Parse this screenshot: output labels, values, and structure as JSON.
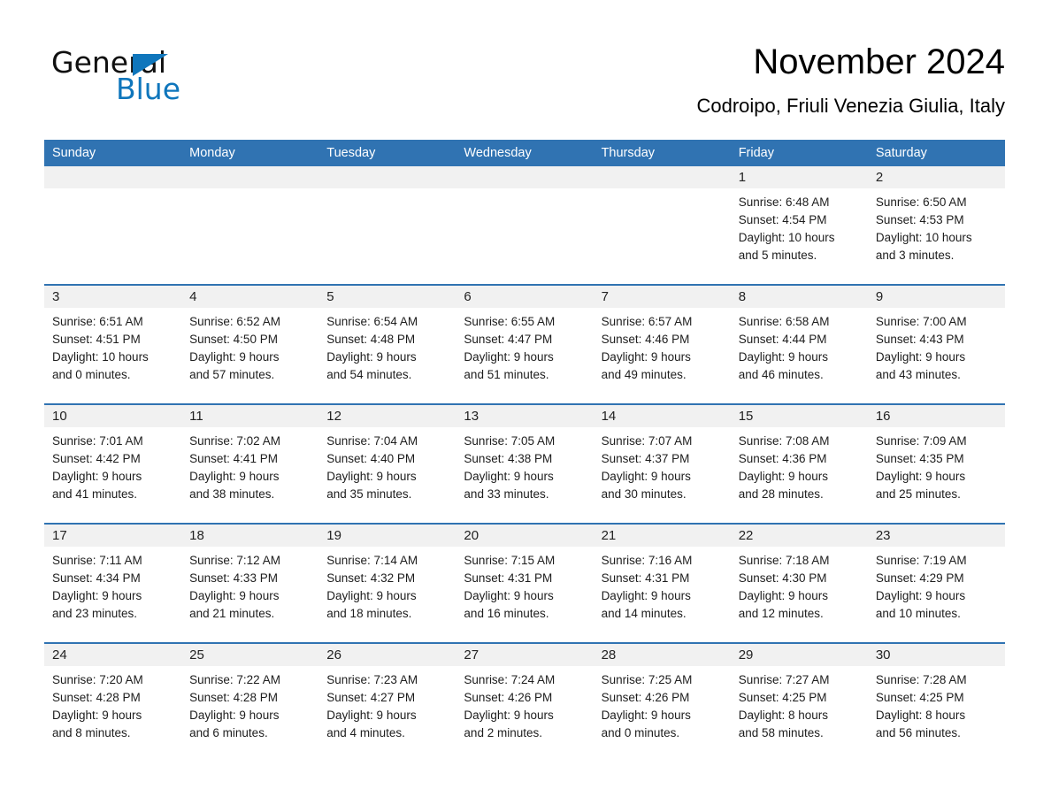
{
  "brand": {
    "name_part1": "General",
    "name_part2": "Blue",
    "accent_color": "#0f76bc",
    "triangle_icon": "triangle-logo-icon"
  },
  "header": {
    "title": "November 2024",
    "location": "Codroipo, Friuli Venezia Giulia, Italy"
  },
  "calendar": {
    "header_color": "#3073b2",
    "daynum_band_color": "#f1f1f1",
    "weekdays": [
      "Sunday",
      "Monday",
      "Tuesday",
      "Wednesday",
      "Thursday",
      "Friday",
      "Saturday"
    ],
    "labels": {
      "sunrise": "Sunrise:",
      "sunset": "Sunset:",
      "daylight": "Daylight:"
    },
    "weeks": [
      [
        {
          "day": "",
          "sunrise": "",
          "sunset": "",
          "daylight_line1": "",
          "daylight_line2": ""
        },
        {
          "day": "",
          "sunrise": "",
          "sunset": "",
          "daylight_line1": "",
          "daylight_line2": ""
        },
        {
          "day": "",
          "sunrise": "",
          "sunset": "",
          "daylight_line1": "",
          "daylight_line2": ""
        },
        {
          "day": "",
          "sunrise": "",
          "sunset": "",
          "daylight_line1": "",
          "daylight_line2": ""
        },
        {
          "day": "",
          "sunrise": "",
          "sunset": "",
          "daylight_line1": "",
          "daylight_line2": ""
        },
        {
          "day": "1",
          "sunrise": "Sunrise: 6:48 AM",
          "sunset": "Sunset: 4:54 PM",
          "daylight_line1": "Daylight: 10 hours",
          "daylight_line2": "and 5 minutes."
        },
        {
          "day": "2",
          "sunrise": "Sunrise: 6:50 AM",
          "sunset": "Sunset: 4:53 PM",
          "daylight_line1": "Daylight: 10 hours",
          "daylight_line2": "and 3 minutes."
        }
      ],
      [
        {
          "day": "3",
          "sunrise": "Sunrise: 6:51 AM",
          "sunset": "Sunset: 4:51 PM",
          "daylight_line1": "Daylight: 10 hours",
          "daylight_line2": "and 0 minutes."
        },
        {
          "day": "4",
          "sunrise": "Sunrise: 6:52 AM",
          "sunset": "Sunset: 4:50 PM",
          "daylight_line1": "Daylight: 9 hours",
          "daylight_line2": "and 57 minutes."
        },
        {
          "day": "5",
          "sunrise": "Sunrise: 6:54 AM",
          "sunset": "Sunset: 4:48 PM",
          "daylight_line1": "Daylight: 9 hours",
          "daylight_line2": "and 54 minutes."
        },
        {
          "day": "6",
          "sunrise": "Sunrise: 6:55 AM",
          "sunset": "Sunset: 4:47 PM",
          "daylight_line1": "Daylight: 9 hours",
          "daylight_line2": "and 51 minutes."
        },
        {
          "day": "7",
          "sunrise": "Sunrise: 6:57 AM",
          "sunset": "Sunset: 4:46 PM",
          "daylight_line1": "Daylight: 9 hours",
          "daylight_line2": "and 49 minutes."
        },
        {
          "day": "8",
          "sunrise": "Sunrise: 6:58 AM",
          "sunset": "Sunset: 4:44 PM",
          "daylight_line1": "Daylight: 9 hours",
          "daylight_line2": "and 46 minutes."
        },
        {
          "day": "9",
          "sunrise": "Sunrise: 7:00 AM",
          "sunset": "Sunset: 4:43 PM",
          "daylight_line1": "Daylight: 9 hours",
          "daylight_line2": "and 43 minutes."
        }
      ],
      [
        {
          "day": "10",
          "sunrise": "Sunrise: 7:01 AM",
          "sunset": "Sunset: 4:42 PM",
          "daylight_line1": "Daylight: 9 hours",
          "daylight_line2": "and 41 minutes."
        },
        {
          "day": "11",
          "sunrise": "Sunrise: 7:02 AM",
          "sunset": "Sunset: 4:41 PM",
          "daylight_line1": "Daylight: 9 hours",
          "daylight_line2": "and 38 minutes."
        },
        {
          "day": "12",
          "sunrise": "Sunrise: 7:04 AM",
          "sunset": "Sunset: 4:40 PM",
          "daylight_line1": "Daylight: 9 hours",
          "daylight_line2": "and 35 minutes."
        },
        {
          "day": "13",
          "sunrise": "Sunrise: 7:05 AM",
          "sunset": "Sunset: 4:38 PM",
          "daylight_line1": "Daylight: 9 hours",
          "daylight_line2": "and 33 minutes."
        },
        {
          "day": "14",
          "sunrise": "Sunrise: 7:07 AM",
          "sunset": "Sunset: 4:37 PM",
          "daylight_line1": "Daylight: 9 hours",
          "daylight_line2": "and 30 minutes."
        },
        {
          "day": "15",
          "sunrise": "Sunrise: 7:08 AM",
          "sunset": "Sunset: 4:36 PM",
          "daylight_line1": "Daylight: 9 hours",
          "daylight_line2": "and 28 minutes."
        },
        {
          "day": "16",
          "sunrise": "Sunrise: 7:09 AM",
          "sunset": "Sunset: 4:35 PM",
          "daylight_line1": "Daylight: 9 hours",
          "daylight_line2": "and 25 minutes."
        }
      ],
      [
        {
          "day": "17",
          "sunrise": "Sunrise: 7:11 AM",
          "sunset": "Sunset: 4:34 PM",
          "daylight_line1": "Daylight: 9 hours",
          "daylight_line2": "and 23 minutes."
        },
        {
          "day": "18",
          "sunrise": "Sunrise: 7:12 AM",
          "sunset": "Sunset: 4:33 PM",
          "daylight_line1": "Daylight: 9 hours",
          "daylight_line2": "and 21 minutes."
        },
        {
          "day": "19",
          "sunrise": "Sunrise: 7:14 AM",
          "sunset": "Sunset: 4:32 PM",
          "daylight_line1": "Daylight: 9 hours",
          "daylight_line2": "and 18 minutes."
        },
        {
          "day": "20",
          "sunrise": "Sunrise: 7:15 AM",
          "sunset": "Sunset: 4:31 PM",
          "daylight_line1": "Daylight: 9 hours",
          "daylight_line2": "and 16 minutes."
        },
        {
          "day": "21",
          "sunrise": "Sunrise: 7:16 AM",
          "sunset": "Sunset: 4:31 PM",
          "daylight_line1": "Daylight: 9 hours",
          "daylight_line2": "and 14 minutes."
        },
        {
          "day": "22",
          "sunrise": "Sunrise: 7:18 AM",
          "sunset": "Sunset: 4:30 PM",
          "daylight_line1": "Daylight: 9 hours",
          "daylight_line2": "and 12 minutes."
        },
        {
          "day": "23",
          "sunrise": "Sunrise: 7:19 AM",
          "sunset": "Sunset: 4:29 PM",
          "daylight_line1": "Daylight: 9 hours",
          "daylight_line2": "and 10 minutes."
        }
      ],
      [
        {
          "day": "24",
          "sunrise": "Sunrise: 7:20 AM",
          "sunset": "Sunset: 4:28 PM",
          "daylight_line1": "Daylight: 9 hours",
          "daylight_line2": "and 8 minutes."
        },
        {
          "day": "25",
          "sunrise": "Sunrise: 7:22 AM",
          "sunset": "Sunset: 4:28 PM",
          "daylight_line1": "Daylight: 9 hours",
          "daylight_line2": "and 6 minutes."
        },
        {
          "day": "26",
          "sunrise": "Sunrise: 7:23 AM",
          "sunset": "Sunset: 4:27 PM",
          "daylight_line1": "Daylight: 9 hours",
          "daylight_line2": "and 4 minutes."
        },
        {
          "day": "27",
          "sunrise": "Sunrise: 7:24 AM",
          "sunset": "Sunset: 4:26 PM",
          "daylight_line1": "Daylight: 9 hours",
          "daylight_line2": "and 2 minutes."
        },
        {
          "day": "28",
          "sunrise": "Sunrise: 7:25 AM",
          "sunset": "Sunset: 4:26 PM",
          "daylight_line1": "Daylight: 9 hours",
          "daylight_line2": "and 0 minutes."
        },
        {
          "day": "29",
          "sunrise": "Sunrise: 7:27 AM",
          "sunset": "Sunset: 4:25 PM",
          "daylight_line1": "Daylight: 8 hours",
          "daylight_line2": "and 58 minutes."
        },
        {
          "day": "30",
          "sunrise": "Sunrise: 7:28 AM",
          "sunset": "Sunset: 4:25 PM",
          "daylight_line1": "Daylight: 8 hours",
          "daylight_line2": "and 56 minutes."
        }
      ]
    ]
  }
}
